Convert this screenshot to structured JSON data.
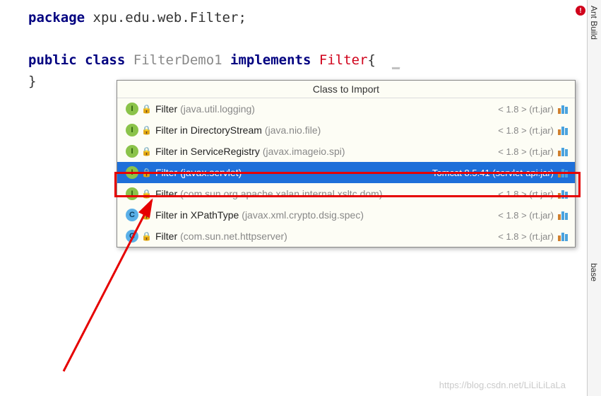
{
  "code": {
    "package_kw": "package",
    "package_name": "xpu.edu.web.Filter",
    "semicolon": ";",
    "public_kw": "public",
    "class_kw": "class",
    "class_name": "FilterDemo1",
    "implements_kw": "implements",
    "interface_name": "Filter",
    "open_brace": "{",
    "close_brace": "}"
  },
  "popup": {
    "title": "Class to Import",
    "items": [
      {
        "kind": "I",
        "name": "Filter",
        "detail": "(java.util.logging)",
        "right": "< 1.8 > (rt.jar)",
        "selected": false
      },
      {
        "kind": "I",
        "name": "Filter in DirectoryStream",
        "detail": "(java.nio.file)",
        "right": "< 1.8 > (rt.jar)",
        "selected": false
      },
      {
        "kind": "I",
        "name": "Filter in ServiceRegistry",
        "detail": "(javax.imageio.spi)",
        "right": "< 1.8 > (rt.jar)",
        "selected": false
      },
      {
        "kind": "I",
        "name": "Filter",
        "detail": "(javax.servlet)",
        "right": "Tomcat 8.5.41 (servlet-api.jar)",
        "selected": true
      },
      {
        "kind": "I",
        "name": "Filter",
        "detail": "(com.sun.org.apache.xalan.internal.xsltc.dom)",
        "right": "< 1.8 > (rt.jar)",
        "selected": false
      },
      {
        "kind": "C",
        "name": "Filter in XPathType",
        "detail": "(javax.xml.crypto.dsig.spec)",
        "right": "< 1.8 > (rt.jar)",
        "selected": false
      },
      {
        "kind": "C",
        "name": "Filter",
        "detail": "(com.sun.net.httpserver)",
        "right": "< 1.8 > (rt.jar)",
        "selected": false
      }
    ]
  },
  "sidebar": {
    "tabs": [
      "Ant Build",
      "base"
    ]
  },
  "error_badge": "!",
  "watermark": "https://blog.csdn.net/LiLiLiLaLa"
}
